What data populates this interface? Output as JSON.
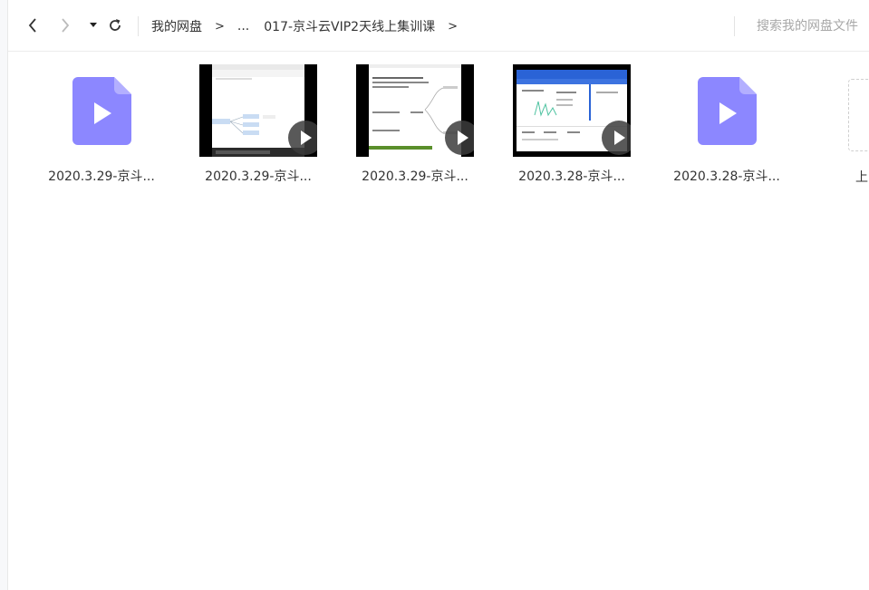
{
  "toolbar": {
    "breadcrumb": [
      "我的网盘",
      "...",
      "017-京斗云VIP2天线上集训课"
    ],
    "separator": ">",
    "search_placeholder": "搜索我的网盘文件"
  },
  "files": [
    {
      "name": "2020.3.29-京斗...",
      "kind": "video-file-icon"
    },
    {
      "name": "2020.3.29-京斗...",
      "kind": "video-thumbnail"
    },
    {
      "name": "2020.3.29-京斗...",
      "kind": "video-thumbnail"
    },
    {
      "name": "2020.3.28-京斗...",
      "kind": "video-thumbnail"
    },
    {
      "name": "2020.3.28-京斗...",
      "kind": "video-file-icon"
    }
  ],
  "upload": {
    "label": "上"
  },
  "colors": {
    "video_icon": "#8c87ff",
    "accent_blue": "#2a63d6"
  }
}
